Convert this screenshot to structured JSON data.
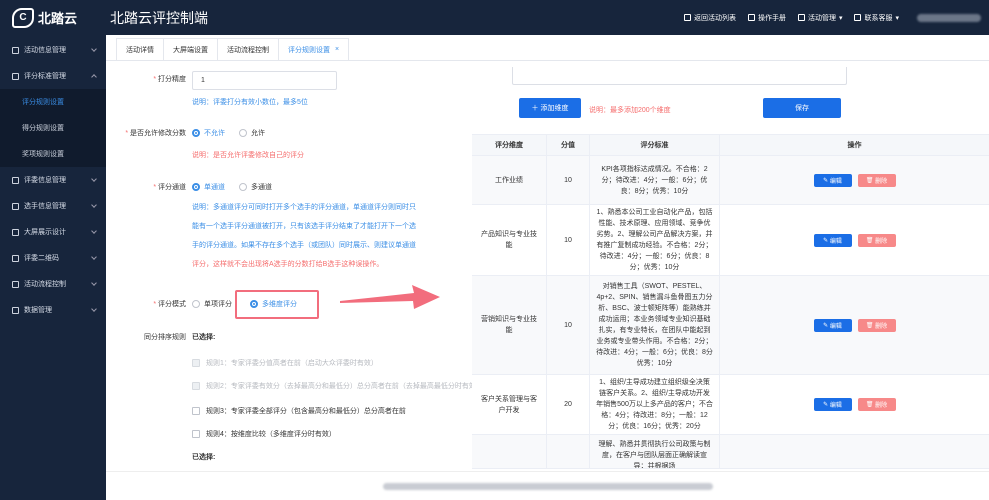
{
  "app": {
    "logo_text": "北踏云",
    "title": "北踏云评控制端"
  },
  "topbar": {
    "actions": [
      "返回活动列表",
      "操作手册",
      "活动管理",
      "联系客服"
    ]
  },
  "sidebar": {
    "items": [
      {
        "label": "活动信息管理",
        "icon": "doc-icon"
      },
      {
        "label": "评分标准管理",
        "icon": "edit-icon",
        "expanded": true
      },
      {
        "label": "评委信息管理",
        "icon": "user-icon"
      },
      {
        "label": "选手信息管理",
        "icon": "person-icon"
      },
      {
        "label": "大屏展示设计",
        "icon": "monitor-icon"
      },
      {
        "label": "评委二维码",
        "icon": "qrcode-icon"
      },
      {
        "label": "活动流程控制",
        "icon": "clock-icon"
      },
      {
        "label": "数据管理",
        "icon": "calendar-icon"
      }
    ],
    "sub_items": [
      "评分规则设置",
      "得分规则设置",
      "奖项规则设置"
    ]
  },
  "tabs": [
    "活动详情",
    "大屏端设置",
    "活动流程控制",
    "评分规则设置"
  ],
  "form": {
    "score_precision": {
      "label": "打分精度",
      "value": "1",
      "hint": "说明：评委打分有效小数位，最多5位"
    },
    "allow_modify": {
      "label": "是否允许修改分数",
      "options": [
        "不允许",
        "允许"
      ],
      "selected": "不允许",
      "hint": "说明：是否允许评委修改自己的评分"
    },
    "score_channel": {
      "label": "评分通道",
      "options": [
        "单通道",
        "多通道"
      ],
      "selected": "单通道",
      "desc_lines": [
        "说明：多通道评分可同时打开多个选手的评分通道，单通道评分则同时只",
        "能有一个选手评分通道被打开，只有该选手评分结束了才能打开下一个选",
        "手的评分通道。如果不存在多个选手（或团队）同时展示、则建议单通道",
        "评分，这样就不会出现将A选手的分数打给B选手这种误操作。"
      ]
    },
    "score_mode": {
      "label": "评分模式",
      "options": [
        "单项评分",
        "多维度评分"
      ],
      "selected": "多维度评分"
    },
    "same_score_rule": {
      "label": "同分排序规则",
      "selected_label": "已选择:",
      "rules": [
        {
          "text": "规则1：专家评委分值高者在前（启动大众评委时有效）",
          "disabled": true
        },
        {
          "text": "规则2：专家评委有效分（去掉最高分和最低分）总分高者在前（去掉最高最低分时有效）",
          "disabled": true
        },
        {
          "text": "规则3：专家评委全部评分（包含最高分和最低分）总分高者在前",
          "disabled": false
        },
        {
          "text": "规则4：按维度比较（多维度评分时有效）",
          "disabled": false
        }
      ],
      "selected_label_2": "已选择:"
    }
  },
  "dimensions": {
    "add_button": "添加维度",
    "limit_hint": "说明：最多添加200个维度",
    "save_button": "保存",
    "columns": [
      "评分维度",
      "分值",
      "评分标准",
      "操作"
    ],
    "edit_label": "编辑",
    "delete_label": "删除",
    "rows": [
      {
        "name": "工作业绩",
        "score": "10",
        "criteria": "KPI各项指标达成情况。不合格：2分；待改进：4分；一般：6分；优良：8分；优秀：10分"
      },
      {
        "name": "产品知识与专业技能",
        "score": "10",
        "criteria": "1、熟悉本公司工业自动化产品，包括性能、技术原理、应用领域、竞争优劣势。2、理解公司产品解决方案，并有推广复制成功经验。不合格：2分；待改进：4分；一般：6分；优良：8分；优秀：10分"
      },
      {
        "name": "营销知识与专业技能",
        "score": "10",
        "criteria": "对销售工具（SWOT、PESTEL、4p+2、SPIN、销售漏斗鱼骨图五力分析、BSC、波士顿矩阵等）能熟练并成功运用；本业务领域专业知识基础扎实，有专业特长，在团队中能起到业务或专业带头作用。不合格：2分；待改进：4分；一般：6分；优良：8分优秀：10分"
      },
      {
        "name": "客户关系管理与客户开发",
        "score": "20",
        "criteria": "1、组织/主导成功建立组织级全决策链客户关系。2、组织/主导成功开发年销售500万以上多产品的客户；不合格：4分；待改进：8分；一般：12分；优良：16分；优秀：20分"
      },
      {
        "name": "",
        "score": "",
        "criteria": "理解、熟悉并贯彻执行公司政策与制度，在客户与团队层面正确解读宣导；并根据场"
      }
    ]
  }
}
